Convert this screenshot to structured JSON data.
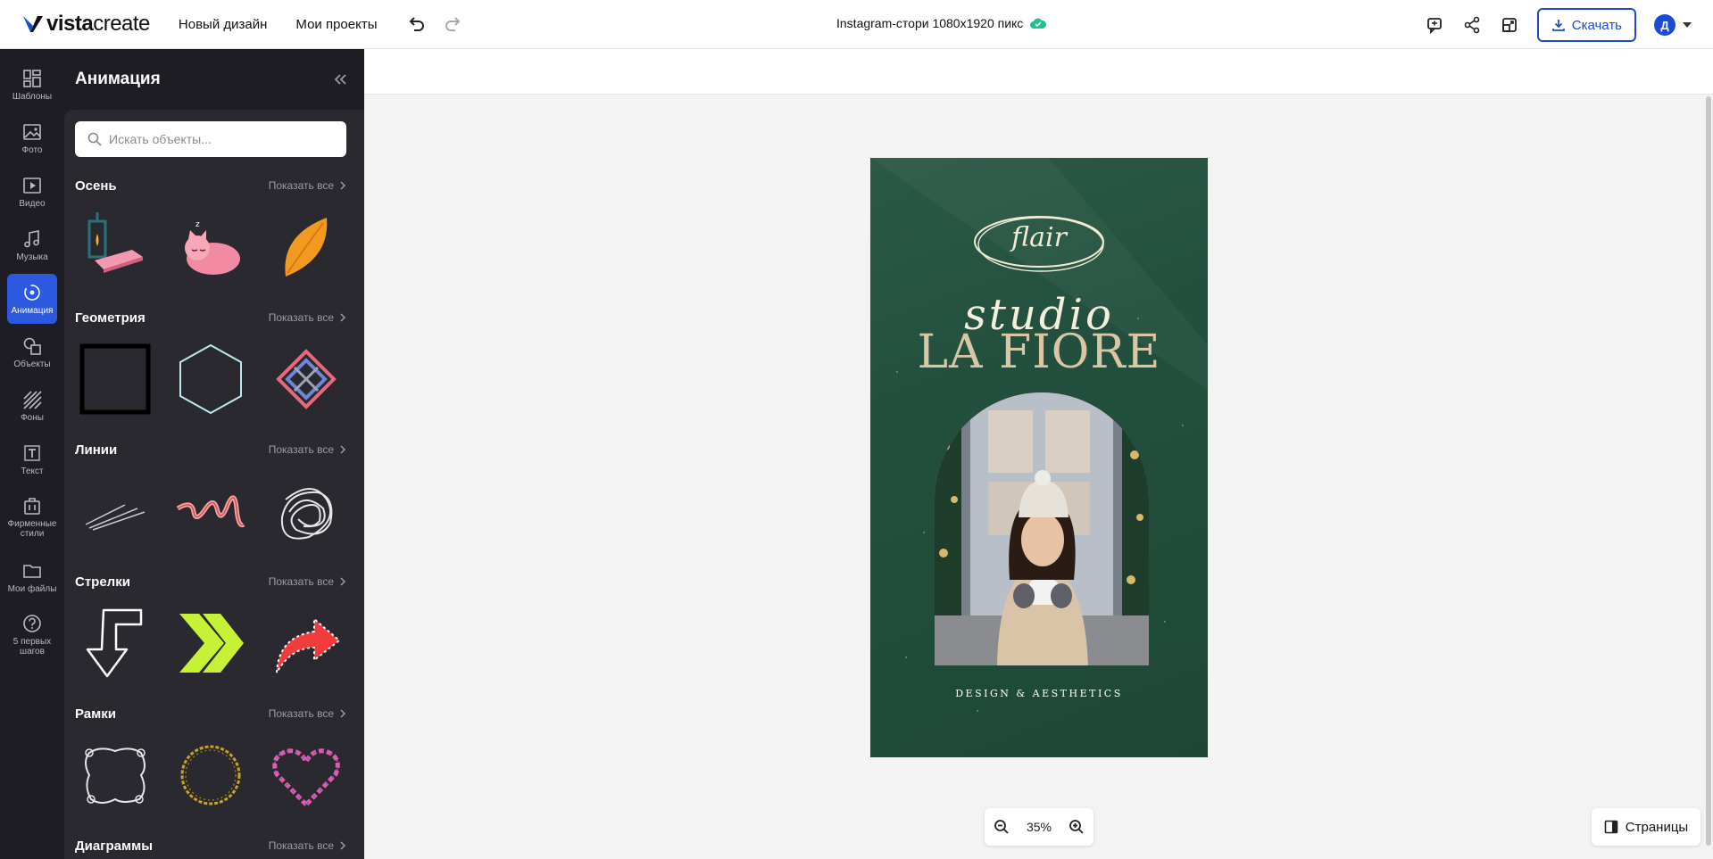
{
  "app": {
    "logo_bold": "vista",
    "logo_rest": "create",
    "nav": [
      "Новый дизайн",
      "Мои проекты"
    ],
    "doc_title": "Instagram-стори 1080x1920  пикс",
    "download_label": "Скачать",
    "avatar_letter": "Д",
    "accent_color": "#2c59e0"
  },
  "rail": {
    "items": [
      {
        "label": "Шаблоны",
        "icon": "templates-icon"
      },
      {
        "label": "Фото",
        "icon": "photo-icon"
      },
      {
        "label": "Видео",
        "icon": "video-icon"
      },
      {
        "label": "Музыка",
        "icon": "music-icon"
      },
      {
        "label": "Анимация",
        "icon": "animation-icon",
        "active": true
      },
      {
        "label": "Объекты",
        "icon": "objects-icon"
      },
      {
        "label": "Фоны",
        "icon": "backgrounds-icon"
      },
      {
        "label": "Текст",
        "icon": "text-icon"
      },
      {
        "label": "Фирменные стили",
        "icon": "brand-kit-icon"
      },
      {
        "label": "Мои файлы",
        "icon": "folder-icon"
      },
      {
        "label": "5 первых шагов",
        "icon": "help-icon"
      }
    ]
  },
  "panel": {
    "title": "Анимация",
    "search_placeholder": "Искать объекты...",
    "show_all": "Показать все",
    "sections": [
      {
        "title": "Осень"
      },
      {
        "title": "Геометрия"
      },
      {
        "title": "Линии"
      },
      {
        "title": "Стрелки"
      },
      {
        "title": "Рамки"
      },
      {
        "title": "Диаграммы"
      }
    ]
  },
  "artboard": {
    "logo_text": "flair",
    "line1": "studio",
    "line2": "LA FIORE",
    "tagline": "DESIGN & AESTHETICS"
  },
  "zoom": {
    "value": "35%"
  },
  "pages_label": "Страницы"
}
